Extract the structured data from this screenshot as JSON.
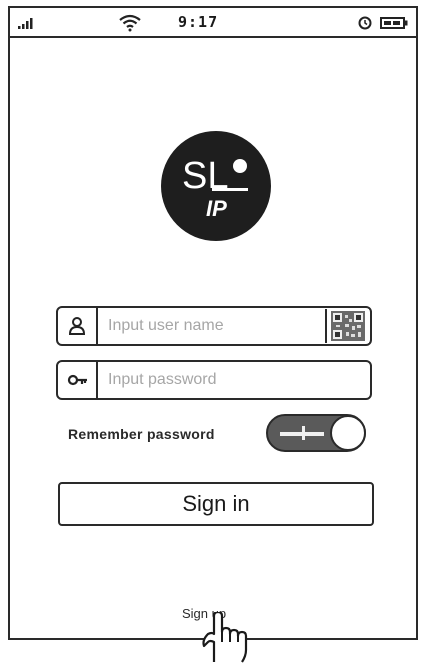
{
  "status_bar": {
    "time": "9:17",
    "signal_icon": "signal-bars-icon",
    "wifi_icon": "wifi-icon",
    "alarm_icon": "alarm-clock-icon",
    "battery_icon": "battery-icon"
  },
  "logo": {
    "text_top": "SL",
    "text_bottom": "IP",
    "background_color": "#1e1e1e"
  },
  "login_form": {
    "username": {
      "placeholder": "Input user name",
      "value": "",
      "icon": "user-icon",
      "scan_button_icon": "qr-code-icon"
    },
    "password": {
      "placeholder": "Input password",
      "value": "",
      "icon": "key-icon"
    },
    "remember_password": {
      "label": "Remember password",
      "enabled": true
    },
    "sign_in_label": "Sign in"
  },
  "sign_up_label": "Sign up",
  "pointer_icon": "hand-pointer-icon"
}
